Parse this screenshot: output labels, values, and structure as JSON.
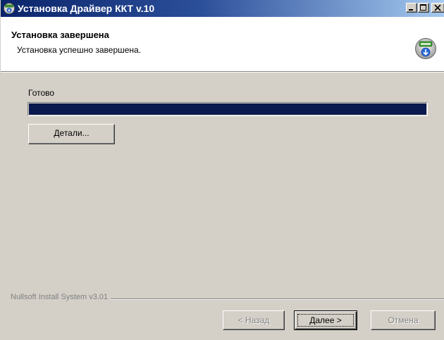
{
  "window": {
    "title": "Установка Драйвер ККТ v.10"
  },
  "header": {
    "title": "Установка завершена",
    "subtitle": "Установка успешно завершена."
  },
  "body": {
    "status_label": "Готово",
    "progress_percent": 100,
    "details_button": "Детали..."
  },
  "footer": {
    "branding": "Nullsoft Install System v3.01",
    "back_button": "< Назад",
    "next_button": "Далее >",
    "cancel_button": "Отмена"
  },
  "colors": {
    "progress_fill": "#0a1a4f",
    "titlebar_start": "#0a246a",
    "titlebar_end": "#a6caf0"
  },
  "icons": {
    "title": "installer-icon",
    "header": "install-disk-icon"
  }
}
